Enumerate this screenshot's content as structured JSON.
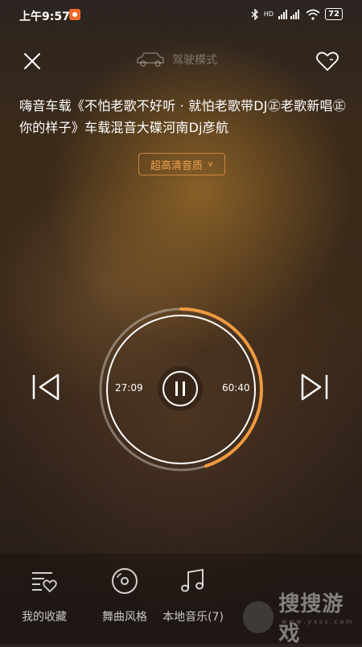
{
  "status_bar": {
    "time": "上午9:57",
    "signal_labels": "HD",
    "battery": "72"
  },
  "header": {
    "mode_label": "驾驶模式"
  },
  "song": {
    "title": "嗨音车载《不怕老歌不好听 · 就怕老歌带DJ㊣老歌新唱㊣你的样子》车载混音大碟河南Dj彦航"
  },
  "quality": {
    "label": "超高清音质",
    "arrow": "∨"
  },
  "player": {
    "current_time": "27:09",
    "total_time": "60:40",
    "progress_fraction": 0.45,
    "state": "playing"
  },
  "bottom_nav": {
    "items": [
      {
        "label": "我的收藏",
        "icon": "favorites-list-icon"
      },
      {
        "label": "舞曲风格",
        "icon": "disc-icon"
      },
      {
        "label": "本地音乐(7)",
        "icon": "music-note-icon"
      }
    ]
  },
  "watermark": {
    "text": "搜搜游戏",
    "sub": "w w w . y x s s . c o m"
  },
  "colors": {
    "accent": "#f0a050",
    "progress": "#f09a40"
  }
}
